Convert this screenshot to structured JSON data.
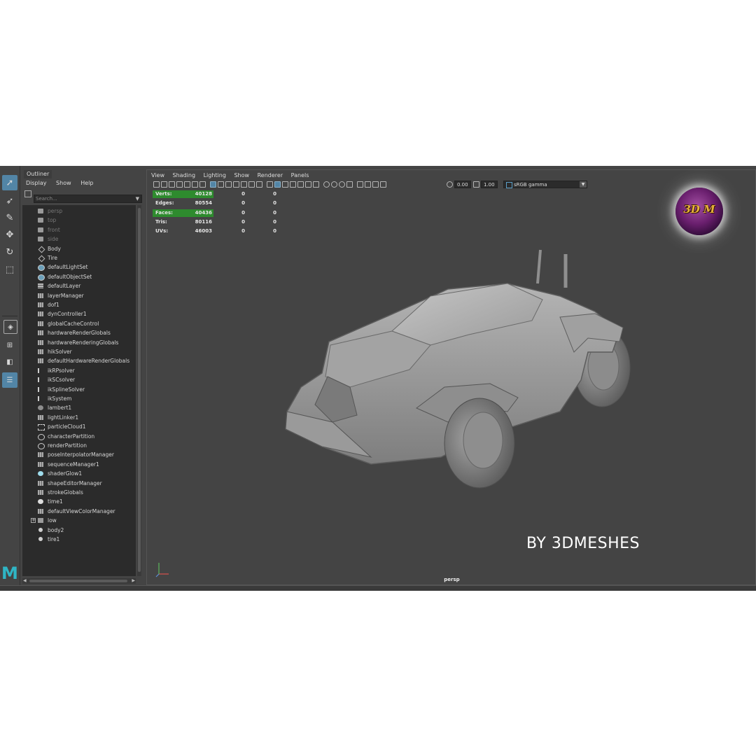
{
  "toolbox": {
    "tools": [
      "select-tool",
      "lasso-tool",
      "paint-select-tool",
      "move-tool",
      "rotate-tool",
      "scale-tool"
    ],
    "logo_letter": "M"
  },
  "outliner": {
    "tab_title": "Outliner",
    "menu": [
      "Display",
      "Show",
      "Help"
    ],
    "search_placeholder": "Search...",
    "items": [
      {
        "label": "persp",
        "icon": "camera-icon",
        "dim": true
      },
      {
        "label": "top",
        "icon": "camera-icon",
        "dim": true
      },
      {
        "label": "front",
        "icon": "camera-icon",
        "dim": true
      },
      {
        "label": "side",
        "icon": "camera-icon",
        "dim": true
      },
      {
        "label": "Body",
        "icon": "transform-icon"
      },
      {
        "label": "Tire",
        "icon": "transform-icon"
      },
      {
        "label": "defaultLightSet",
        "icon": "set-icon"
      },
      {
        "label": "defaultObjectSet",
        "icon": "set-icon"
      },
      {
        "label": "defaultLayer",
        "icon": "layer-icon"
      },
      {
        "label": "layerManager",
        "icon": "utility-icon"
      },
      {
        "label": "dof1",
        "icon": "utility-icon"
      },
      {
        "label": "dynController1",
        "icon": "utility-icon"
      },
      {
        "label": "globalCacheControl",
        "icon": "utility-icon"
      },
      {
        "label": "hardwareRenderGlobals",
        "icon": "utility-icon"
      },
      {
        "label": "hardwareRenderingGlobals",
        "icon": "utility-icon"
      },
      {
        "label": "hikSolver",
        "icon": "utility-icon"
      },
      {
        "label": "defaultHardwareRenderGlobals",
        "icon": "utility-icon"
      },
      {
        "label": "ikRPsolver",
        "icon": "ik-icon"
      },
      {
        "label": "ikSCsolver",
        "icon": "ik-icon"
      },
      {
        "label": "ikSplineSolver",
        "icon": "ik-icon"
      },
      {
        "label": "ikSystem",
        "icon": "ik-icon"
      },
      {
        "label": "lambert1",
        "icon": "material-icon"
      },
      {
        "label": "lightLinker1",
        "icon": "utility-icon"
      },
      {
        "label": "particleCloud1",
        "icon": "particle-icon"
      },
      {
        "label": "characterPartition",
        "icon": "partition-icon"
      },
      {
        "label": "renderPartition",
        "icon": "partition-icon"
      },
      {
        "label": "poseInterpolatorManager",
        "icon": "utility-icon"
      },
      {
        "label": "sequenceManager1",
        "icon": "utility-icon"
      },
      {
        "label": "shaderGlow1",
        "icon": "glow-icon"
      },
      {
        "label": "shapeEditorManager",
        "icon": "utility-icon"
      },
      {
        "label": "strokeGlobals",
        "icon": "utility-icon"
      },
      {
        "label": "time1",
        "icon": "clock-icon"
      },
      {
        "label": "defaultViewColorManager",
        "icon": "utility-icon"
      },
      {
        "label": "low",
        "icon": "group-icon",
        "expandable": true
      },
      {
        "label": "body2",
        "icon": "object-icon"
      },
      {
        "label": "tire1",
        "icon": "object-icon"
      }
    ]
  },
  "viewport": {
    "menu": [
      "View",
      "Shading",
      "Lighting",
      "Show",
      "Renderer",
      "Panels"
    ],
    "exposure": "0.00",
    "gamma": "1.00",
    "color_space": "sRGB gamma",
    "camera": "persp",
    "hud": [
      {
        "label": "Verts:",
        "v1": "40128",
        "v2": "0",
        "v3": "0",
        "highlight": true
      },
      {
        "label": "Edges:",
        "v1": "80554",
        "v2": "0",
        "v3": "0",
        "highlight": false
      },
      {
        "label": "Faces:",
        "v1": "40436",
        "v2": "0",
        "v3": "0",
        "highlight": true
      },
      {
        "label": "Tris:",
        "v1": "80116",
        "v2": "0",
        "v3": "0",
        "highlight": false
      },
      {
        "label": "UVs:",
        "v1": "46003",
        "v2": "0",
        "v3": "0",
        "highlight": false
      }
    ],
    "logo_text": "3D M",
    "watermark": "BY 3DMESHES",
    "colors": {
      "hud_highlight": "#2e8b2e",
      "selection": "#5285a6",
      "logo_purple": "#6a1f6e",
      "logo_gold": "#e7b23a"
    }
  }
}
